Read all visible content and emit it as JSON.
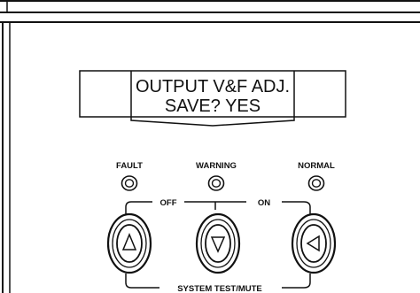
{
  "display": {
    "line1": "OUTPUT V&F ADJ.",
    "line2": "SAVE? YES"
  },
  "indicators": [
    {
      "label": "FAULT"
    },
    {
      "label": "WARNING"
    },
    {
      "label": "NORMAL"
    }
  ],
  "bracket": {
    "off_label": "OFF",
    "on_label": "ON",
    "system_label": "SYSTEM TEST/MUTE"
  },
  "buttons": [
    {
      "icon": "triangle-up-icon"
    },
    {
      "icon": "triangle-down-icon"
    },
    {
      "icon": "triangle-left-icon"
    }
  ]
}
